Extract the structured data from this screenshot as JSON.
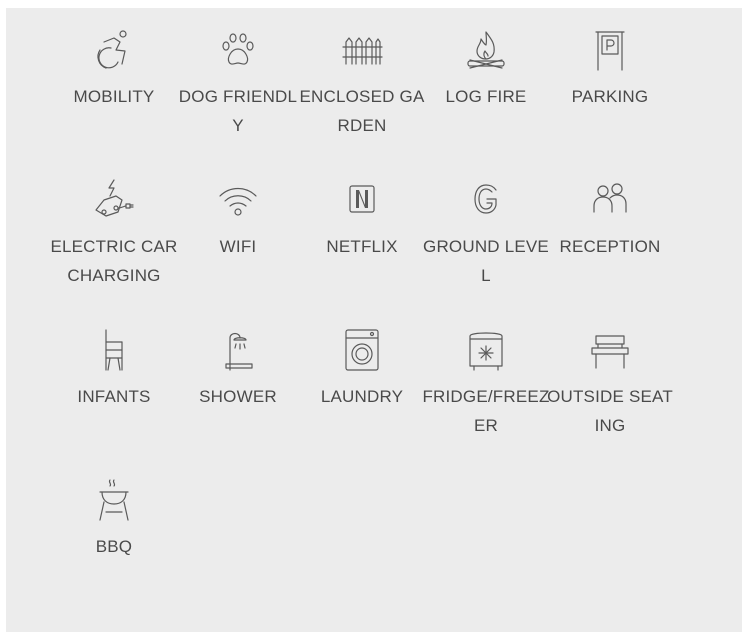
{
  "amenities": [
    {
      "icon": "wheelchair-icon",
      "label": "MOBILITY"
    },
    {
      "icon": "paw-icon",
      "label": "DOG FRIENDLY"
    },
    {
      "icon": "fence-icon",
      "label": "ENCLOSED GARDEN"
    },
    {
      "icon": "log-fire-icon",
      "label": "LOG FIRE"
    },
    {
      "icon": "parking-icon",
      "label": "PARKING"
    },
    {
      "icon": "electric-car-icon",
      "label": "ELECTRIC CAR CHARGING"
    },
    {
      "icon": "wifi-icon",
      "label": "WIFI"
    },
    {
      "icon": "netflix-icon",
      "label": "NETFLIX"
    },
    {
      "icon": "ground-level-icon",
      "label": "GROUND LEVEL"
    },
    {
      "icon": "reception-icon",
      "label": "RECEPTION"
    },
    {
      "icon": "high-chair-icon",
      "label": "INFANTS"
    },
    {
      "icon": "shower-icon",
      "label": "SHOWER"
    },
    {
      "icon": "washing-machine-icon",
      "label": "LAUNDRY"
    },
    {
      "icon": "fridge-icon",
      "label": "FRIDGE/FREEZER"
    },
    {
      "icon": "bench-icon",
      "label": "OUTSIDE SEATING"
    },
    {
      "icon": "bbq-icon",
      "label": "BBQ"
    }
  ]
}
